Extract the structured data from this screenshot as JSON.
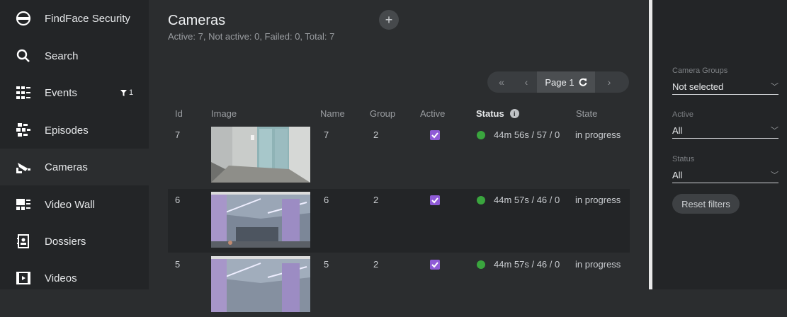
{
  "sidebar": {
    "app_name": "FindFace Security",
    "items": [
      {
        "label": "Search"
      },
      {
        "label": "Events",
        "filter_count": "1"
      },
      {
        "label": "Episodes"
      },
      {
        "label": "Cameras"
      },
      {
        "label": "Video Wall"
      },
      {
        "label": "Dossiers"
      },
      {
        "label": "Videos"
      }
    ]
  },
  "main": {
    "title": "Cameras",
    "subtitle": "Active: 7, Not active: 0, Failed: 0, Total: 7",
    "add_label": "+",
    "pager": {
      "first": "«",
      "prev": "‹",
      "page_label": "Page 1",
      "next": "›"
    },
    "columns": {
      "id": "Id",
      "image": "Image",
      "name": "Name",
      "group": "Group",
      "active": "Active",
      "status": "Status",
      "state": "State"
    },
    "rows": [
      {
        "id": "7",
        "name": "7",
        "group": "2",
        "active": true,
        "status_text": "44m 56s / 57 / 0",
        "state": "in progress"
      },
      {
        "id": "6",
        "name": "6",
        "group": "2",
        "active": true,
        "status_text": "44m 57s / 46 / 0",
        "state": "in progress"
      },
      {
        "id": "5",
        "name": "5",
        "group": "2",
        "active": true,
        "status_text": "44m 57s / 46 / 0",
        "state": "in progress"
      }
    ],
    "status_color": "#3aa53e",
    "checkbox_color": "#8f5bd6"
  },
  "filters": {
    "camera_groups": {
      "label": "Camera Groups",
      "value": "Not selected"
    },
    "active": {
      "label": "Active",
      "value": "All"
    },
    "status": {
      "label": "Status",
      "value": "All"
    },
    "reset_label": "Reset filters"
  }
}
